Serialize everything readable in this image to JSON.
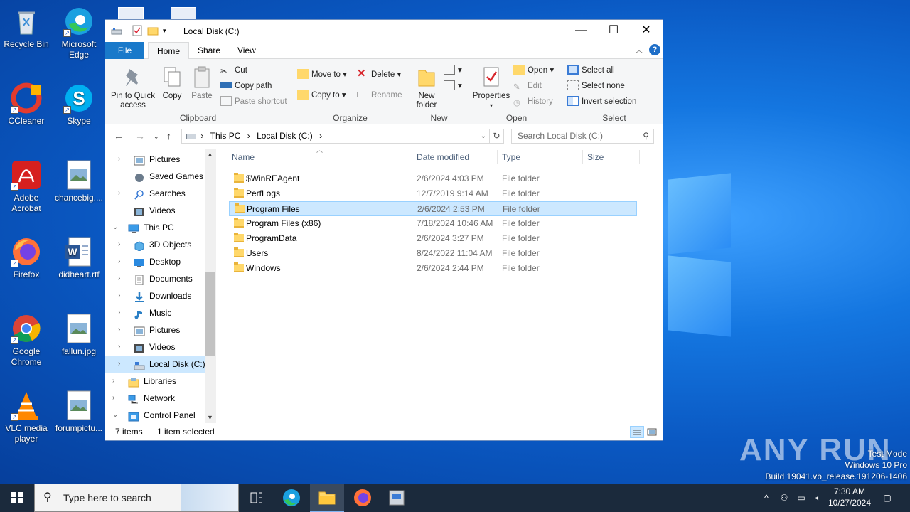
{
  "desktop": {
    "icons": [
      {
        "label": "Recycle Bin"
      },
      {
        "label": "Microsoft Edge"
      },
      {
        "label": "CCleaner"
      },
      {
        "label": "Skype"
      },
      {
        "label": "Adobe Acrobat"
      },
      {
        "label": "chancebig...."
      },
      {
        "label": "Firefox"
      },
      {
        "label": "didheart.rtf"
      },
      {
        "label": "Google Chrome"
      },
      {
        "label": "fallun.jpg"
      },
      {
        "label": "VLC media player"
      },
      {
        "label": "forumpictu..."
      }
    ],
    "watermark": "ANY RUN",
    "test_mode": [
      "Test Mode",
      "Windows 10 Pro",
      "Build 19041.vb_release.191206-1406"
    ]
  },
  "window": {
    "title": "Local Disk (C:)",
    "controls": {
      "minimize": "—",
      "maximize": "☐",
      "close": "✕"
    }
  },
  "ribbon_tabs": [
    "File",
    "Home",
    "Share",
    "View"
  ],
  "ribbon": {
    "clipboard": {
      "label": "Clipboard",
      "pin": "Pin to Quick access",
      "copy": "Copy",
      "paste": "Paste",
      "cut": "Cut",
      "copy_path": "Copy path",
      "paste_shortcut": "Paste shortcut"
    },
    "organize": {
      "label": "Organize",
      "move_to": "Move to",
      "copy_to": "Copy to",
      "delete": "Delete",
      "rename": "Rename"
    },
    "new": {
      "label": "New",
      "new_folder": "New folder"
    },
    "open": {
      "label": "Open",
      "properties": "Properties",
      "open": "Open",
      "edit": "Edit",
      "history": "History"
    },
    "select": {
      "label": "Select",
      "select_all": "Select all",
      "select_none": "Select none",
      "invert": "Invert selection"
    }
  },
  "address": {
    "crumbs": [
      "This PC",
      "Local Disk (C:)"
    ],
    "search_placeholder": "Search Local Disk (C:)"
  },
  "nav_pane": [
    {
      "label": "Pictures",
      "icon": "pictures-icon",
      "indent": 1,
      "chevron": "›"
    },
    {
      "label": "Saved Games",
      "icon": "saved-games-icon",
      "indent": 1,
      "chevron": ""
    },
    {
      "label": "Searches",
      "icon": "searches-icon",
      "indent": 1,
      "chevron": "›"
    },
    {
      "label": "Videos",
      "icon": "videos-icon",
      "indent": 1,
      "chevron": ""
    },
    {
      "label": "This PC",
      "icon": "this-pc-icon",
      "indent": 0,
      "chevron": "⌄"
    },
    {
      "label": "3D Objects",
      "icon": "3d-objects-icon",
      "indent": 1,
      "chevron": "›"
    },
    {
      "label": "Desktop",
      "icon": "desktop-icon",
      "indent": 1,
      "chevron": "›"
    },
    {
      "label": "Documents",
      "icon": "documents-icon",
      "indent": 1,
      "chevron": "›"
    },
    {
      "label": "Downloads",
      "icon": "downloads-icon",
      "indent": 1,
      "chevron": "›"
    },
    {
      "label": "Music",
      "icon": "music-icon",
      "indent": 1,
      "chevron": "›"
    },
    {
      "label": "Pictures",
      "icon": "pictures-icon",
      "indent": 1,
      "chevron": "›"
    },
    {
      "label": "Videos",
      "icon": "videos-icon",
      "indent": 1,
      "chevron": "›"
    },
    {
      "label": "Local Disk (C:)",
      "icon": "drive-icon",
      "indent": 1,
      "chevron": "›",
      "selected": true
    },
    {
      "label": "Libraries",
      "icon": "libraries-icon",
      "indent": 0,
      "chevron": "›"
    },
    {
      "label": "Network",
      "icon": "network-icon",
      "indent": 0,
      "chevron": "›"
    },
    {
      "label": "Control Panel",
      "icon": "control-panel-icon",
      "indent": 0,
      "chevron": "⌄"
    }
  ],
  "columns": [
    "Name",
    "Date modified",
    "Type",
    "Size"
  ],
  "files": [
    {
      "name": "$WinREAgent",
      "date": "2/6/2024 4:03 PM",
      "type": "File folder",
      "size": ""
    },
    {
      "name": "PerfLogs",
      "date": "12/7/2019 9:14 AM",
      "type": "File folder",
      "size": ""
    },
    {
      "name": "Program Files",
      "date": "2/6/2024 2:53 PM",
      "type": "File folder",
      "size": "",
      "selected": true
    },
    {
      "name": "Program Files (x86)",
      "date": "7/18/2024 10:46 AM",
      "type": "File folder",
      "size": ""
    },
    {
      "name": "ProgramData",
      "date": "2/6/2024 3:27 PM",
      "type": "File folder",
      "size": ""
    },
    {
      "name": "Users",
      "date": "8/24/2022 11:04 AM",
      "type": "File folder",
      "size": ""
    },
    {
      "name": "Windows",
      "date": "2/6/2024 2:44 PM",
      "type": "File folder",
      "size": ""
    }
  ],
  "status": {
    "items": "7 items",
    "selected": "1 item selected"
  },
  "taskbar": {
    "search_placeholder": "Type here to search",
    "time": "7:30 AM",
    "date": "10/27/2024"
  },
  "colors": {
    "accent": "#1979ca",
    "selection": "#cce8ff",
    "taskbar": "#1b2a3c"
  }
}
